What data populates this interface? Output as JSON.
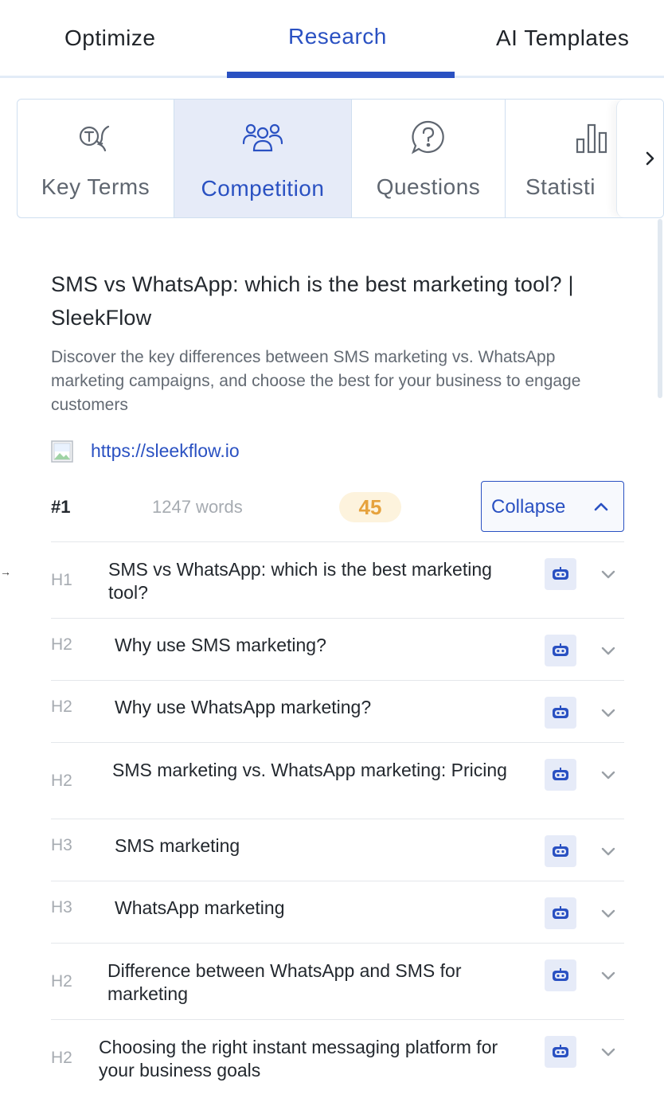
{
  "top_tabs": {
    "items": [
      "Optimize",
      "Research",
      "AI Templates"
    ],
    "active": "Research"
  },
  "sub_tabs": {
    "items": [
      {
        "label": "Key Terms",
        "icon": "key-terms-icon"
      },
      {
        "label": "Competition",
        "icon": "people-icon"
      },
      {
        "label": "Questions",
        "icon": "question-icon"
      },
      {
        "label": "Statisti",
        "icon": "bar-chart-icon"
      }
    ],
    "active": "Competition",
    "next_icon": "chevron-right-icon"
  },
  "result": {
    "title": "SMS vs WhatsApp: which is the best marketing tool? | SleekFlow",
    "description": "Discover the key differences between SMS marketing vs. WhatsApp marketing campaigns, and choose the best for your business to engage customers",
    "url": "https://sleekflow.io",
    "rank": "#1",
    "words": "1247 words",
    "score": "45",
    "collapse_label": "Collapse"
  },
  "left_marker": "→",
  "headings": [
    {
      "tag": "H1",
      "text": "SMS vs WhatsApp: which is the best marketing tool?"
    },
    {
      "tag": "H2",
      "text": "Why use SMS marketing?"
    },
    {
      "tag": "H2",
      "text": "Why use WhatsApp marketing?"
    },
    {
      "tag": "H2",
      "text": "SMS marketing vs. WhatsApp marketing: Pricing"
    },
    {
      "tag": "H3",
      "text": "SMS marketing"
    },
    {
      "tag": "H3",
      "text": "WhatsApp marketing"
    },
    {
      "tag": "H2",
      "text": "Difference between WhatsApp and SMS for marketing"
    },
    {
      "tag": "H2",
      "text": "Choosing the right instant messaging platform for your business goals"
    }
  ],
  "colors": {
    "accent": "#2a51c2",
    "active_tab_bg": "#e6ebf8",
    "score_text": "#e6a23c",
    "score_bg": "#fdf3dd"
  }
}
